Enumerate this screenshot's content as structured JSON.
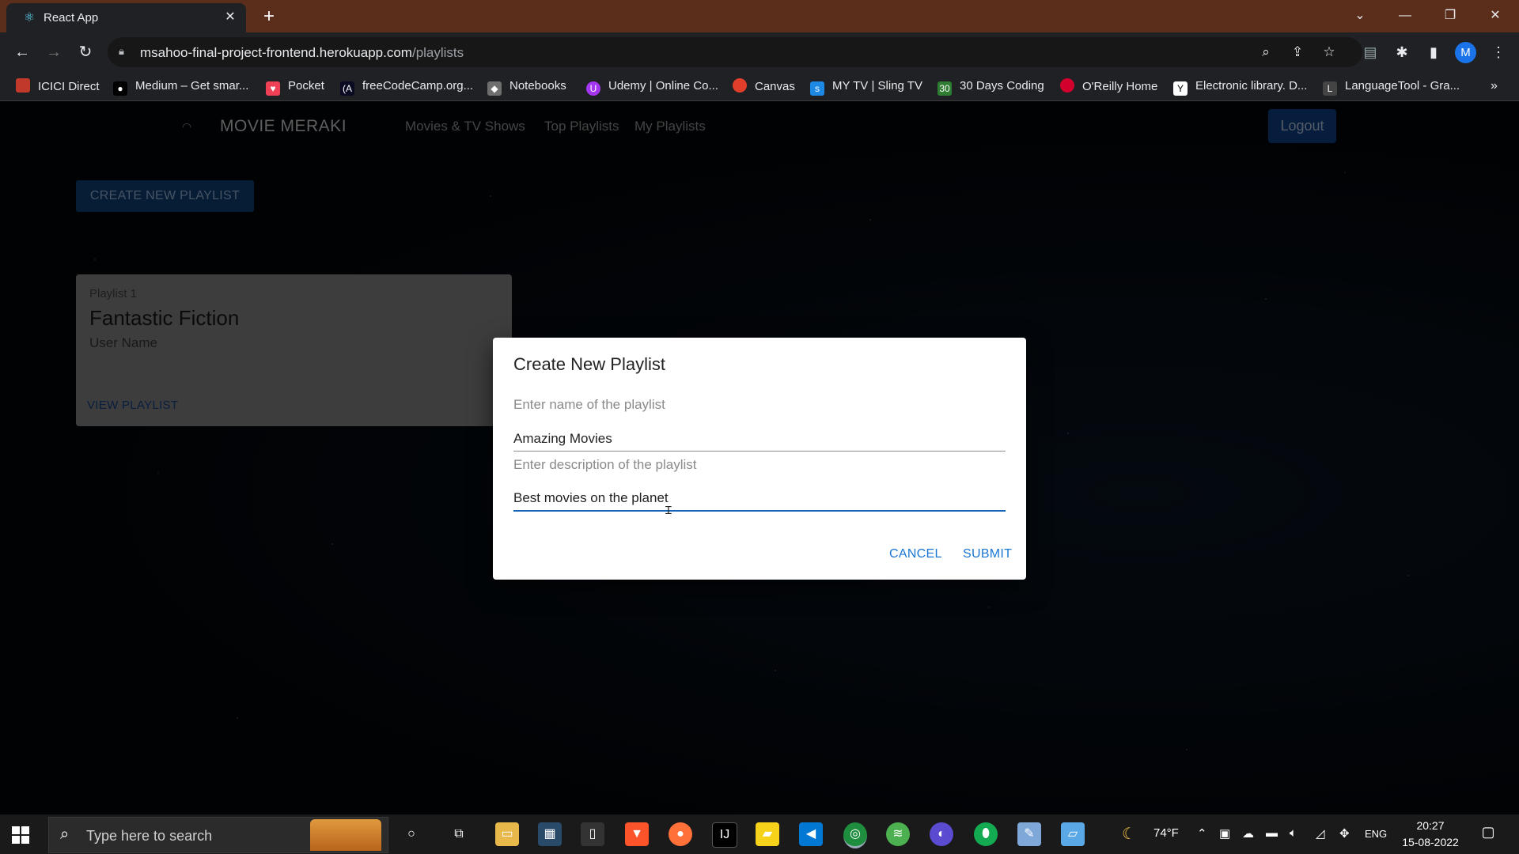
{
  "browser": {
    "tab_title": "React App",
    "url_host": "msahoo-final-project-frontend.herokuapp.com",
    "url_path": "/playlists",
    "profile_initial": "M",
    "bookmarks": [
      {
        "label": "ICICI Direct",
        "color": "#c0392b"
      },
      {
        "label": "Medium – Get smar...",
        "color": "#000000"
      },
      {
        "label": "Pocket",
        "color": "#ef4056"
      },
      {
        "label": "freeCodeCamp.org...",
        "color": "#0a0a23"
      },
      {
        "label": "Notebooks",
        "color": "#6f6f6f"
      },
      {
        "label": "Udemy | Online Co...",
        "color": "#a435f0"
      },
      {
        "label": "Canvas",
        "color": "#e13f2b"
      },
      {
        "label": "MY TV | Sling TV",
        "color": "#1e88e5"
      },
      {
        "label": "30 Days Coding",
        "color": "#2e7d32"
      },
      {
        "label": "O'Reilly Home",
        "color": "#d3002d"
      },
      {
        "label": "Electronic library. D...",
        "color": "#ffffff"
      },
      {
        "label": "LanguageTool - Gra...",
        "color": "#444444"
      }
    ]
  },
  "app": {
    "brand": "MOVIE MERAKI",
    "nav": {
      "movies": "Movies & TV Shows",
      "top_playlists": "Top Playlists",
      "my_playlists": "My Playlists"
    },
    "logout_label": "Logout",
    "create_button_label": "CREATE NEW PLAYLIST",
    "playlist_card": {
      "number": "Playlist 1",
      "name": "Fantastic Fiction",
      "user": "User Name",
      "view_label": "VIEW PLAYLIST"
    }
  },
  "dialog": {
    "title": "Create New Playlist",
    "name_label": "Enter name of the playlist",
    "name_value": "Amazing Movies",
    "description_label": "Enter description of the playlist",
    "description_value": "Best movies on the planet",
    "cancel_label": "CANCEL",
    "submit_label": "SUBMIT"
  },
  "taskbar": {
    "search_placeholder": "Type here to search",
    "weather": "74°F",
    "language": "ENG",
    "time": "20:27",
    "date": "15-08-2022"
  }
}
